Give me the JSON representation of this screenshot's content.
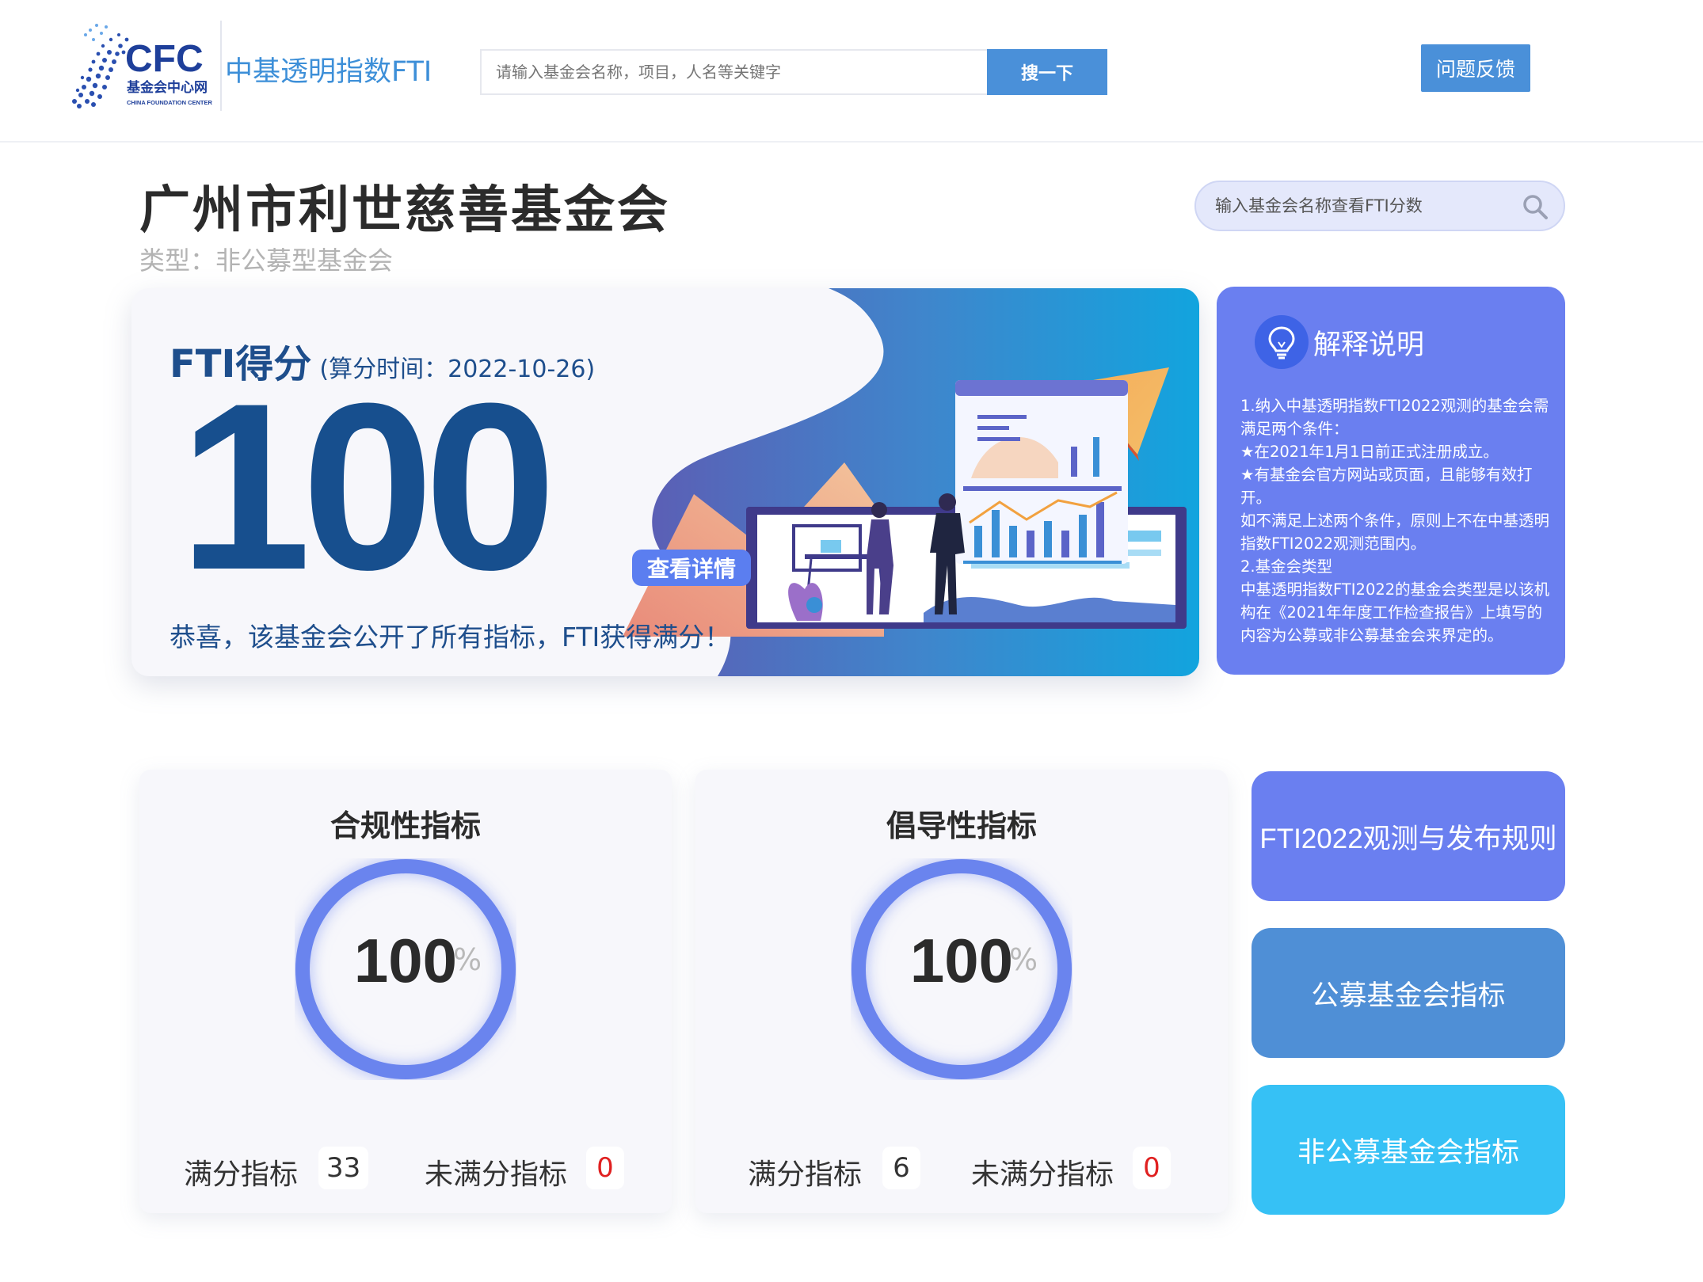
{
  "header": {
    "logo_text": "CFC",
    "logo_sub": "基金会中心网",
    "logo_en": "CHINA FOUNDATION CENTER",
    "site_name": "中基透明指数FTI",
    "search_placeholder": "请输入基金会名称，项目，人名等关键字",
    "search_button": "搜一下",
    "feedback_button": "问题反馈"
  },
  "org": {
    "name": "广州市利世慈善基金会",
    "type": "类型：非公募型基金会",
    "search_placeholder": "输入基金会名称查看FTI分数"
  },
  "score": {
    "label": "FTI得分",
    "time": "(算分时间：2022-10-26)",
    "value": "100",
    "value_num": 100,
    "message": "恭喜，该基金会公开了所有指标，FTI获得满分！",
    "detail_button": "查看详情"
  },
  "explanation": {
    "title": "解释说明",
    "lines": [
      "1.纳入中基透明指数FTI2022观测的基金会需满足两个条件：",
      "★在2021年1月1日前正式注册成立。",
      "★有基金会官方网站或页面，且能够有效打开。",
      "如不满足上述两个条件，原则上不在中基透明指数FTI2022观测范围内。",
      "2.基金会类型",
      "中基透明指数FTI2022的基金会类型是以该机构在《2021年年度工作检查报告》上填写的内容为公募或非公募基金会来界定的。"
    ]
  },
  "indicators": [
    {
      "title": "合规性指标",
      "percent": "100",
      "percent_num": 100,
      "unit": "%",
      "full_label": "满分指标",
      "full_count": "33",
      "notfull_label": "未满分指标",
      "notfull_count": "0"
    },
    {
      "title": "倡导性指标",
      "percent": "100",
      "percent_num": 100,
      "unit": "%",
      "full_label": "满分指标",
      "full_count": "6",
      "notfull_label": "未满分指标",
      "notfull_count": "0"
    }
  ],
  "side_buttons": [
    {
      "label": "FTI2022观测与发布规则",
      "color": "#6a7ff0"
    },
    {
      "label": "公募基金会指标",
      "color": "#4f8fd6"
    },
    {
      "label": "非公募基金会指标",
      "color": "#36c1f5"
    }
  ],
  "colors": {
    "primary_blue": "#4a90d9",
    "score_blue": "#174f8e",
    "ring_blue": "#6a84ee",
    "panel_purple": "#6a7ff0",
    "alert_red": "#e02020"
  }
}
